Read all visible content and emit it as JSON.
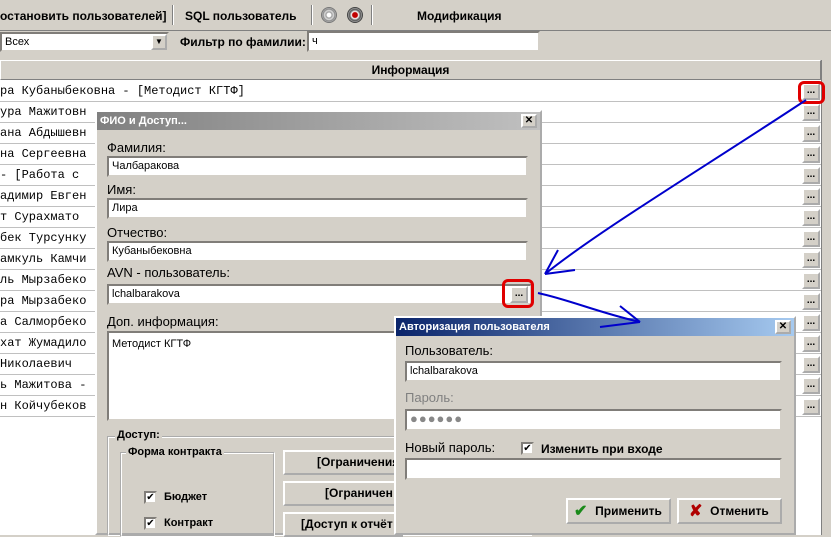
{
  "toolbar": {
    "restore_users": "остановить пользователей]",
    "sql_user": "SQL пользователь",
    "modification": "Модификация"
  },
  "filter": {
    "combo_value": "Всех",
    "surname_label": "Фильтр по фамилии:",
    "surname_value": "ч"
  },
  "grid": {
    "header": "Информация",
    "rows": [
      "ра Кубаныбековна - [Методист КГТФ]",
      "ура Мажитовн",
      "ана Абдышевн",
      "на Сергеевна",
      " - [Работа с",
      "адимир Евген",
      "т  Сурахмато",
      "бек Турсунку",
      "амкуль Камчи",
      "ль Мырзабеко",
      "ра Мырзабеко",
      "а Салморбеко",
      "хат Жумадило",
      " Николаевич",
      "ь Мажитова -",
      "н Койчубеков"
    ],
    "ellipsis": "..."
  },
  "fio_dialog": {
    "title": "ФИО и Доступ...",
    "surname_label": "Фамилия:",
    "surname": "Чалбаракова",
    "name_label": "Имя:",
    "name": "Лира",
    "patronymic_label": "Отчество:",
    "patronymic": "Кубаныбековна",
    "avn_label": "AVN - пользователь:",
    "avn_user": "lchalbarakova",
    "extra_label": "Доп. информация:",
    "extra_info": "Методист КГТФ",
    "access_label": "Доступ:",
    "contract_label": "Форма контракта",
    "budget_label": "Бюджет",
    "contract_cb_label": "Контракт",
    "btn_limit1": "[Ограничения",
    "btn_limit2": "[Ограничен",
    "btn_reports": "[Доступ к отчёт"
  },
  "auth_dialog": {
    "title": "Авторизация пользователя",
    "user_label": "Пользователь:",
    "user_value": "lchalbarakova",
    "password_label": "Пароль:",
    "password_value": "●●●●●●",
    "new_password_label": "Новый пароль:",
    "change_on_login": "Изменить при входе",
    "apply": "Применить",
    "cancel": "Отменить"
  },
  "colors": {
    "accent_blue": "#0000cc",
    "highlight_red": "#e00000",
    "apply_green": "#1a8a1a",
    "cancel_red": "#b00000"
  }
}
